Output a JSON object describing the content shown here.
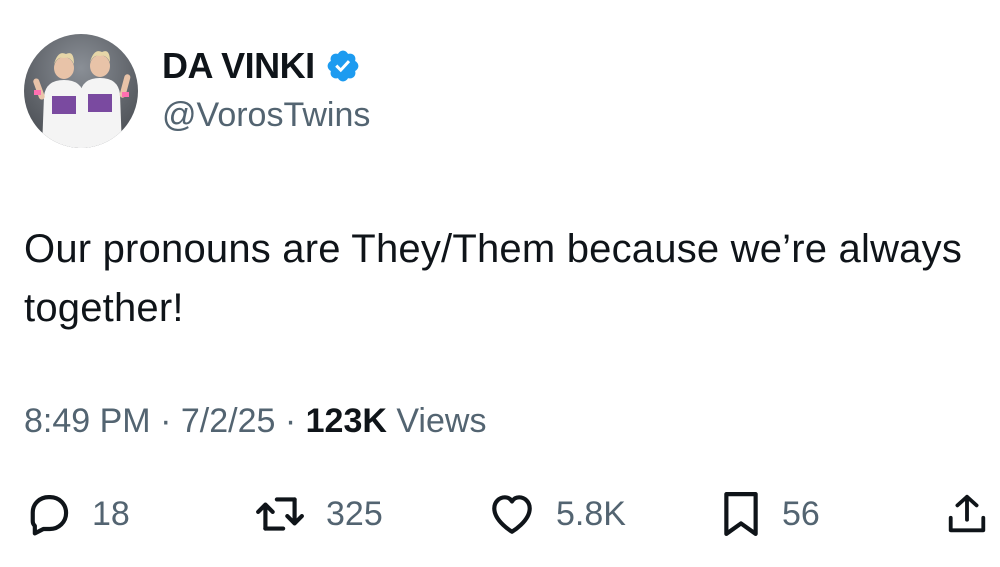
{
  "author": {
    "display_name": "DA VINKI",
    "handle": "@VorosTwins",
    "verified": true,
    "verified_color": "#1d9bf0"
  },
  "tweet": {
    "text": "Our pronouns are They/Them because we’re always together!",
    "time": "8:49 PM",
    "date": "7/2/25",
    "separator": "·",
    "views_count": "123K",
    "views_label": "Views"
  },
  "actions": {
    "reply": {
      "icon": "reply-icon",
      "count": "18"
    },
    "repost": {
      "icon": "repost-icon",
      "count": "325"
    },
    "like": {
      "icon": "heart-icon",
      "count": "5.8K"
    },
    "bookmark": {
      "icon": "bookmark-icon",
      "count": "56"
    },
    "share": {
      "icon": "share-icon"
    }
  },
  "colors": {
    "text_primary": "#0f1419",
    "text_secondary": "#536471",
    "background": "#ffffff"
  }
}
